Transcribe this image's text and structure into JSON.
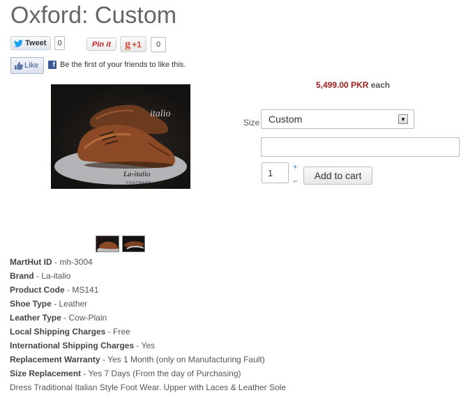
{
  "product": {
    "title": "Oxford: Custom",
    "image_alt": "Brown oxford shoes"
  },
  "social": {
    "tweet_label": "Tweet",
    "tweet_count": "0",
    "pin_label": "Pin it",
    "gplus_label": "+1",
    "gplus_count": "0",
    "like_label": "Like",
    "fb_text": "Be the first of your friends to like this."
  },
  "cart": {
    "price": "5,499.00 PKR",
    "price_suffix": "each",
    "size_label": "Size",
    "size_value": "Custom",
    "custom_text": "",
    "quantity": "1",
    "qty_plus": "+",
    "qty_minus": "–",
    "add_to_cart_label": "Add to cart"
  },
  "specs": [
    {
      "key": "MartHut ID",
      "value": "mh-3004"
    },
    {
      "key": "Brand",
      "value": "La-italio"
    },
    {
      "key": "Product Code",
      "value": "MS141"
    },
    {
      "key": "Shoe Type",
      "value": "Leather"
    },
    {
      "key": "Leather Type",
      "value": "Cow-Plain"
    },
    {
      "key": "Local Shipping Charges",
      "value": "Free"
    },
    {
      "key": "International Shipping Charges",
      "value": "Yes"
    },
    {
      "key": "Replacement Warranty",
      "value": "Yes 1 Month (only on Manufacturing Fault)"
    },
    {
      "key": "Size Replacement",
      "value": "Yes 7 Days (From the day of Purchasing)"
    }
  ],
  "description": "Dress Traditional Italian Style Foot Wear. Upper with Laces & Leather Sole",
  "image_overlay": {
    "brand_script": "La-italio",
    "brand_sub": "FOOTMARK",
    "top_text": "italio"
  },
  "colors": {
    "price": "#9b1c1c",
    "facebook": "#3b5998",
    "twitter": "#1da1f2",
    "pinterest": "#cb2027",
    "gplus": "#d14836"
  }
}
